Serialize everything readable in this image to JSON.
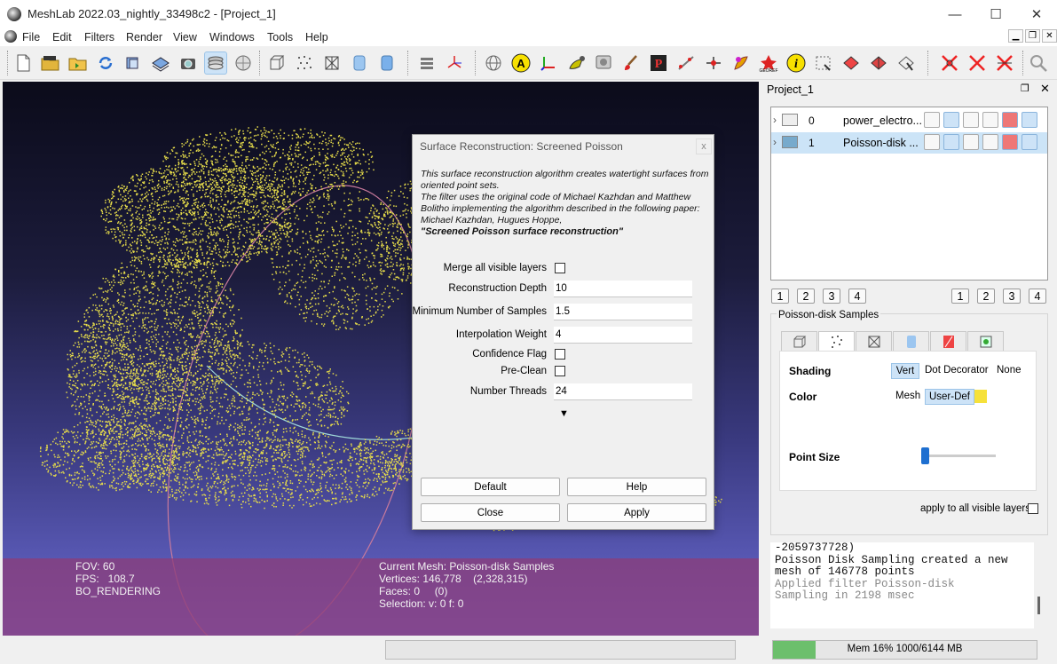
{
  "window": {
    "title": "MeshLab 2022.03_nightly_33498c2 - [Project_1]",
    "minimize_glyph": "—",
    "maximize_glyph": "☐",
    "close_glyph": "✕"
  },
  "menu": [
    "File",
    "Edit",
    "Filters",
    "Render",
    "View",
    "Windows",
    "Tools",
    "Help"
  ],
  "toolbar_icons": [
    "new-project-icon",
    "open-project-icon",
    "import-mesh-icon",
    "reload-icon",
    "save-snapshot-icon",
    "import-raster-icon",
    "snapshot-camera-icon",
    "layers-icon",
    "globe-shell-icon",
    "bounding-box-icon",
    "points-icon",
    "wireframe-icon",
    "flat-shading-icon",
    "smooth-shading-icon",
    "layer-stack-icon",
    "axes-icon",
    "sphere-grid-icon",
    "annotation-a-icon",
    "frame-axes-icon",
    "color-picker-icon",
    "alignment-icon",
    "paint-brush-icon",
    "pickpoints-icon",
    "measure-icon",
    "manipulator-icon",
    "select-paint-icon",
    "georef-icon",
    "info-icon",
    "select-vertices-icon",
    "select-faces-icon",
    "select-connected-icon",
    "delete-vertices-icon",
    "delete-faces-icon",
    "delete-selected-icon",
    "zoom-search-icon"
  ],
  "info_left": {
    "fov": "FOV: 60",
    "fps": "FPS:   108.7",
    "mode": "BO_RENDERING"
  },
  "info_right": {
    "mesh": "Current Mesh: Poisson-disk Samples",
    "vertices": "Vertices: 146,778    (2,328,315)",
    "faces": "Faces: 0     (0)",
    "selection": "Selection: v: 0 f: 0"
  },
  "dialog": {
    "title": "Surface Reconstruction: Screened Poisson",
    "close": "x",
    "desc1": "This surface reconstruction algorithm creates watertight surfaces from oriented point sets.",
    "desc2": "The filter uses the original code of Michael Kazhdan and Matthew Bolitho implementing the algorithm described in the following paper:",
    "desc3": "Michael Kazhdan, Hugues Hoppe,",
    "desc4": "\"Screened Poisson surface reconstruction\"",
    "params": {
      "merge": {
        "label": "Merge all visible layers",
        "checked": false
      },
      "depth": {
        "label": "Reconstruction Depth",
        "value": "10"
      },
      "min_samples": {
        "label": "Minimum Number of Samples",
        "value": "1.5"
      },
      "interp": {
        "label": "Interpolation Weight",
        "value": "4"
      },
      "confidence": {
        "label": "Confidence Flag",
        "checked": false
      },
      "preclean": {
        "label": "Pre-Clean",
        "checked": false
      },
      "threads": {
        "label": "Number Threads",
        "value": "24"
      }
    },
    "expand": "▼",
    "buttons": {
      "default": "Default",
      "help": "Help",
      "close": "Close",
      "apply": "Apply"
    }
  },
  "project": {
    "title": "Project_1",
    "layers": [
      {
        "index": "0",
        "name": "power_electro..."
      },
      {
        "index": "1",
        "name": "Poisson-disk ..."
      }
    ],
    "num_buttons_left": [
      "1",
      "2",
      "3",
      "4"
    ],
    "num_buttons_right": [
      "1",
      "2",
      "3",
      "4"
    ]
  },
  "render_panel": {
    "group_title": "Poisson-disk Samples",
    "shading_label": "Shading",
    "shading_options": [
      "Vert",
      "Dot Decorator",
      "None"
    ],
    "shading_selected": "Vert",
    "color_label": "Color",
    "color_options": [
      "Mesh",
      "User-Def"
    ],
    "color_selected": "User-Def",
    "user_color": "#f6e13a",
    "point_size_label": "Point Size",
    "point_size_level": 0.0,
    "apply_all_label": "apply to all visible layers"
  },
  "log": [
    "-2059737728)",
    "Poisson Disk Sampling created a new",
    "mesh of 146778 points",
    "Applied filter Poisson-disk",
    "Sampling in 2198 msec"
  ],
  "memory": {
    "label": "Mem 16% 1000/6144 MB",
    "fraction": 0.16
  }
}
